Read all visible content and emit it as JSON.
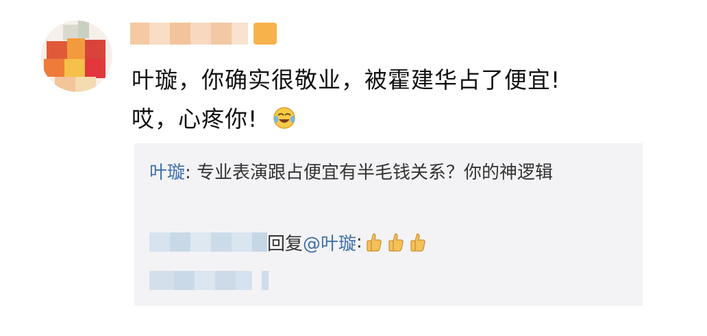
{
  "comment": {
    "line1": "叶璇，你确实很敬业，被霍建华占了便宜!",
    "line2": "哎，心疼你!",
    "emoji_icon": "laughing-crying-face"
  },
  "reply": {
    "author": "叶璇",
    "separator": ": ",
    "text": "专业表演跟占便宜有半毛钱关系？你的神逻辑"
  },
  "subreply": {
    "reply_word": "回复",
    "mention": "@叶璇",
    "colon": ":",
    "emoji_icon": "thumbs-up"
  },
  "colors": {
    "link": "#3f6fa6",
    "text": "#111111",
    "reply_bg": "#f3f3f5"
  }
}
